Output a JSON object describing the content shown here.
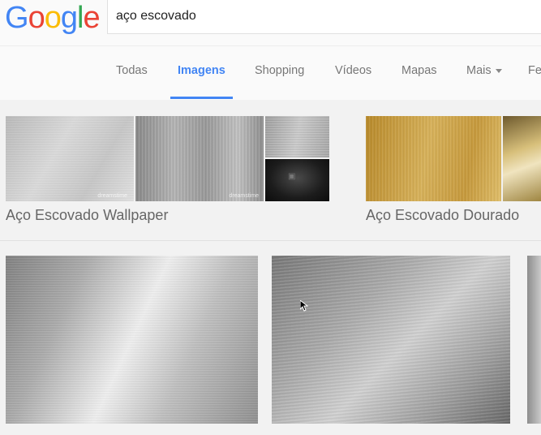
{
  "logo": {
    "letters": [
      {
        "ch": "G",
        "color": "#4285F4"
      },
      {
        "ch": "o",
        "color": "#EA4335"
      },
      {
        "ch": "o",
        "color": "#FBBC05"
      },
      {
        "ch": "g",
        "color": "#4285F4"
      },
      {
        "ch": "l",
        "color": "#34A853"
      },
      {
        "ch": "e",
        "color": "#EA4335"
      }
    ]
  },
  "search": {
    "query": "aço escovado"
  },
  "tabs": [
    {
      "label": "Todas",
      "active": false
    },
    {
      "label": "Imagens",
      "active": true
    },
    {
      "label": "Shopping",
      "active": false
    },
    {
      "label": "Vídeos",
      "active": false
    },
    {
      "label": "Mapas",
      "active": false
    },
    {
      "label": "Mais",
      "active": false
    },
    {
      "label": "Fe",
      "active": false
    }
  ],
  "collections": [
    {
      "title": "Aço Escovado Wallpaper",
      "watermarks": [
        "dreamstime",
        "dreamstime"
      ]
    },
    {
      "title": "Aço Escovado Dourado"
    }
  ],
  "colors": {
    "accent": "#4285F4",
    "tab_text": "#777777",
    "collection_text": "#666666"
  }
}
